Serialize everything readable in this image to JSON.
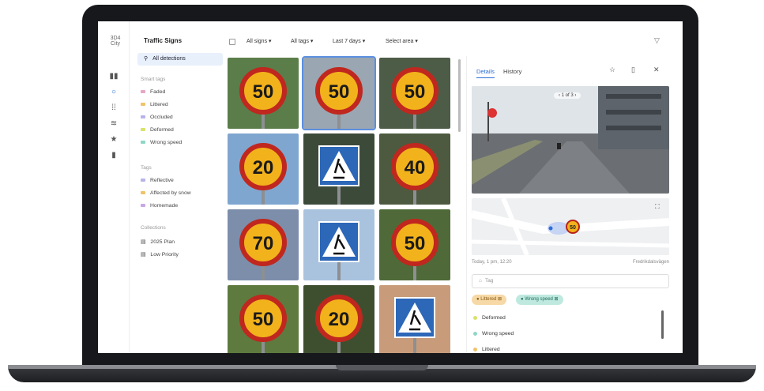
{
  "app": {
    "logo": "3D4 City",
    "title": "Traffic Signs"
  },
  "rail": {
    "icons": [
      "grid-icon",
      "location-pin-icon",
      "columns-icon",
      "chart-icon",
      "star-icon",
      "bookmark-icon"
    ]
  },
  "sidebar": {
    "all_detections": "All detections",
    "smart_tags_heading": "Smart tags",
    "smart_tags": [
      {
        "label": "Faded",
        "color": "#e7a6c6"
      },
      {
        "label": "Littered",
        "color": "#f0c36b"
      },
      {
        "label": "Occluded",
        "color": "#b7b3ea"
      },
      {
        "label": "Deformed",
        "color": "#d9e26a"
      },
      {
        "label": "Wrong speed",
        "color": "#8fd6c6"
      }
    ],
    "tags_heading": "Tags",
    "tags": [
      {
        "label": "Reflective",
        "color": "#b7b3ea"
      },
      {
        "label": "Affected by snow",
        "color": "#f0c36b"
      },
      {
        "label": "Homemade",
        "color": "#c9a6e6"
      }
    ],
    "collections_heading": "Collections",
    "collections": [
      {
        "label": "2025 Plan"
      },
      {
        "label": "Low Priority"
      }
    ]
  },
  "toolbar": {
    "filters": [
      "All signs",
      "All tags",
      "Last 7 days",
      "Select area"
    ]
  },
  "grid": {
    "tiles": [
      {
        "kind": "speed",
        "text": "50",
        "bg": "#5a7d4a"
      },
      {
        "kind": "speed",
        "text": "50",
        "bg": "#9aa6b1"
      },
      {
        "kind": "speed",
        "text": "50",
        "bg": "#4d5c47"
      },
      {
        "kind": "speed",
        "text": "20",
        "bg": "#7fa6cf"
      },
      {
        "kind": "crossing",
        "text": "",
        "bg": "#3c4a3a"
      },
      {
        "kind": "speed",
        "text": "40",
        "bg": "#4e5a3f"
      },
      {
        "kind": "speed",
        "text": "70",
        "bg": "#7d8eab"
      },
      {
        "kind": "crossing",
        "text": "",
        "bg": "#a9c3de"
      },
      {
        "kind": "speed",
        "text": "50",
        "bg": "#4f6a38"
      },
      {
        "kind": "speed",
        "text": "50",
        "bg": "#5e7a3f"
      },
      {
        "kind": "speed",
        "text": "20",
        "bg": "#3e4f2f"
      },
      {
        "kind": "crossing",
        "text": "",
        "bg": "#c89c7a"
      }
    ]
  },
  "detail": {
    "tab_details": "Details",
    "tab_history": "History",
    "photo_counter": "1 of 3",
    "map_sign": "50",
    "date": "Today, 1 pm, 12:20",
    "street": "Fredrikdalsvägen",
    "tag_placeholder": "Tag",
    "chips": [
      {
        "label": "Littered",
        "color": "#f6d9a6",
        "text_color": "#8a5a12"
      },
      {
        "label": "Wrong speed",
        "color": "#bfe9df",
        "text_color": "#1f6e5e"
      }
    ],
    "tag_list": [
      {
        "label": "Deformed",
        "color": "#d9e26a"
      },
      {
        "label": "Wrong speed",
        "color": "#8fd6c6"
      },
      {
        "label": "Littered",
        "color": "#f0c36b"
      }
    ]
  }
}
